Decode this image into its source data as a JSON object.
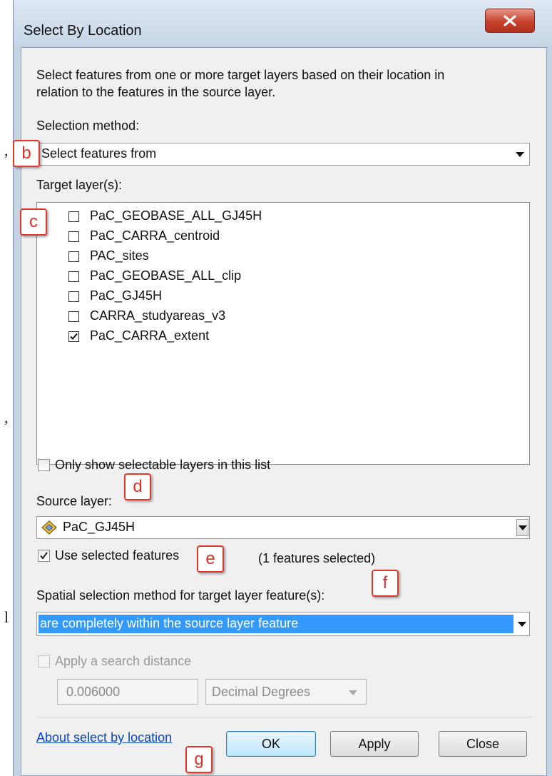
{
  "stray_left_text": [
    ",",
    ",",
    "l"
  ],
  "window": {
    "title": "Select By Location",
    "close_icon": "close-x-icon"
  },
  "description": {
    "line1": "Select features from one or more target layers based on their location in",
    "line2": "relation to the features in the source layer."
  },
  "selection_method": {
    "label": "Selection method:",
    "value": "Select features from"
  },
  "target_layers": {
    "label": "Target layer(s):",
    "items": [
      {
        "label": "PaC_GEOBASE_ALL_GJ45H",
        "checked": false
      },
      {
        "label": "PaC_CARRA_centroid",
        "checked": false
      },
      {
        "label": "PAC_sites",
        "checked": false
      },
      {
        "label": "PaC_GEOBASE_ALL_clip",
        "checked": false
      },
      {
        "label": "PaC_GJ45H",
        "checked": false
      },
      {
        "label": "CARRA_studyareas_v3",
        "checked": false
      },
      {
        "label": "PaC_CARRA_extent",
        "checked": true
      }
    ]
  },
  "only_selectable": {
    "label": "Only show selectable layers in this list",
    "checked": false
  },
  "source_layer": {
    "label": "Source layer:",
    "value": "PaC_GJ45H",
    "icon": "polygon-layer-icon"
  },
  "use_selected": {
    "label": "Use selected features",
    "checked": true,
    "count_text": "(1 features selected)"
  },
  "spatial_method": {
    "label": "Spatial selection method for target layer feature(s):",
    "value": "are completely within the source layer feature"
  },
  "search_distance": {
    "label": "Apply a search distance",
    "checked": false,
    "enabled": false,
    "value": "0.006000",
    "unit": "Decimal Degrees"
  },
  "footer": {
    "about_link": "About select by location",
    "ok": "OK",
    "apply": "Apply",
    "close": "Close"
  },
  "markers": {
    "b": "b",
    "c": "c",
    "d": "d",
    "e": "e",
    "f": "f",
    "g": "g"
  },
  "colors": {
    "accent_selection": "#3399ff",
    "marker_red": "#e0392b",
    "link_blue": "#0645c9"
  }
}
